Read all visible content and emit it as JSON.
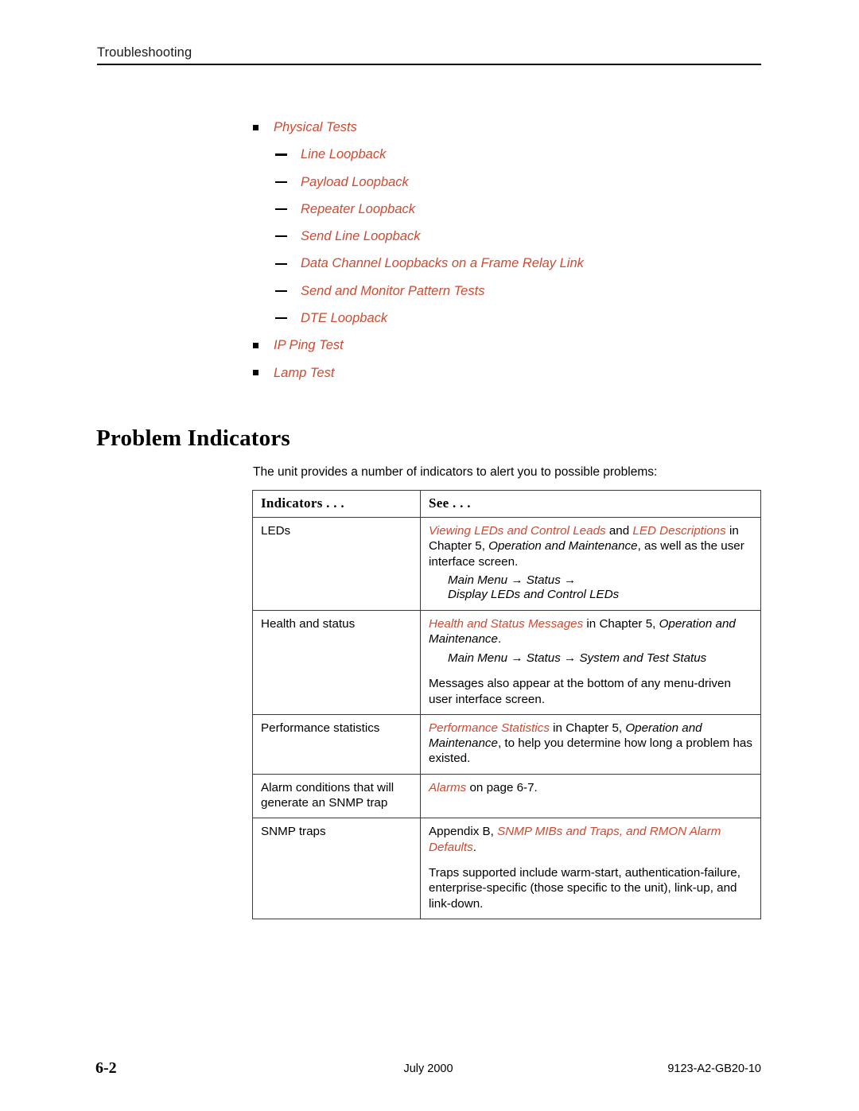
{
  "running_header": {
    "text": "Troubleshooting"
  },
  "intro_list": [
    {
      "level": 1,
      "marker": "square",
      "label": "Physical Tests"
    },
    {
      "level": 2,
      "marker": "dash",
      "label": "Line Loopback"
    },
    {
      "level": 2,
      "marker": "dash",
      "label": "Payload Loopback"
    },
    {
      "level": 2,
      "marker": "dash",
      "label": "Repeater Loopback"
    },
    {
      "level": 2,
      "marker": "dash",
      "label": "Send Line Loopback"
    },
    {
      "level": 2,
      "marker": "dash",
      "label": "Data Channel Loopbacks on a Frame Relay Link"
    },
    {
      "level": 2,
      "marker": "dash",
      "label": "Send and Monitor Pattern Tests"
    },
    {
      "level": 2,
      "marker": "dash",
      "label": "DTE Loopback"
    },
    {
      "level": 1,
      "marker": "square",
      "label": "IP Ping Test"
    },
    {
      "level": 1,
      "marker": "square",
      "label": "Lamp Test"
    }
  ],
  "section": {
    "heading": "Problem Indicators",
    "intro_paragraph": "The unit provides a number of indicators to alert you to possible problems:"
  },
  "table": {
    "headers": [
      "Indicators . . .",
      "See . . ."
    ],
    "rows": [
      {
        "indicator": "LEDs",
        "see_blocks": [
          {
            "type": "paragraph",
            "runs": [
              {
                "style": "xref",
                "text": "Viewing LEDs and Control Leads"
              },
              {
                "style": "plain",
                "text": " and "
              },
              {
                "style": "xref",
                "text": "LED Descriptions"
              },
              {
                "style": "plain",
                "text": " in Chapter 5, "
              },
              {
                "style": "italic",
                "text": "Operation and Maintenance"
              },
              {
                "style": "plain",
                "text": ", as well as the user interface screen."
              }
            ]
          },
          {
            "type": "menu-path",
            "text": "Main Menu → Status →\nDisplay LEDs and Control LEDs"
          }
        ]
      },
      {
        "indicator": "Health and status",
        "see_blocks": [
          {
            "type": "paragraph",
            "runs": [
              {
                "style": "xref",
                "text": "Health and Status Messages"
              },
              {
                "style": "plain",
                "text": " in Chapter 5, "
              },
              {
                "style": "italic",
                "text": "Operation and Maintenance"
              },
              {
                "style": "plain",
                "text": "."
              }
            ]
          },
          {
            "type": "menu-path",
            "text": "Main Menu → Status → System and Test Status"
          },
          {
            "type": "paragraph",
            "runs": [
              {
                "style": "plain",
                "text": "Messages also appear at the bottom of any menu-driven user interface screen."
              }
            ]
          }
        ]
      },
      {
        "indicator": "Performance statistics",
        "see_blocks": [
          {
            "type": "paragraph",
            "runs": [
              {
                "style": "xref",
                "text": "Performance Statistics"
              },
              {
                "style": "plain",
                "text": " in Chapter 5, "
              },
              {
                "style": "italic",
                "text": "Operation and Maintenance"
              },
              {
                "style": "plain",
                "text": ", to help you determine how long a problem has existed."
              }
            ]
          }
        ]
      },
      {
        "indicator": "Alarm conditions that will generate an SNMP trap",
        "see_blocks": [
          {
            "type": "paragraph",
            "runs": [
              {
                "style": "xref",
                "text": "Alarms"
              },
              {
                "style": "plain",
                "text": " on page 6-7."
              }
            ]
          }
        ]
      },
      {
        "indicator": "SNMP traps",
        "see_blocks": [
          {
            "type": "paragraph",
            "runs": [
              {
                "style": "plain",
                "text": "Appendix B, "
              },
              {
                "style": "xref",
                "text": "SNMP MIBs and Traps, and RMON Alarm Defaults"
              },
              {
                "style": "plain",
                "text": "."
              }
            ]
          },
          {
            "type": "paragraph",
            "runs": [
              {
                "style": "plain",
                "text": "Traps supported include warm-start, authentication-failure, enterprise-specific (those specific to the unit), link-up, and link-down."
              }
            ]
          }
        ]
      }
    ]
  },
  "footer": {
    "page_number": "6-2",
    "date": "July 2000",
    "document_number": "9123-A2-GB20-10"
  },
  "colors": {
    "cross_reference": "#CB4B33",
    "text": "#000000",
    "rule": "#000000",
    "table_border": "#3A3A3A"
  }
}
